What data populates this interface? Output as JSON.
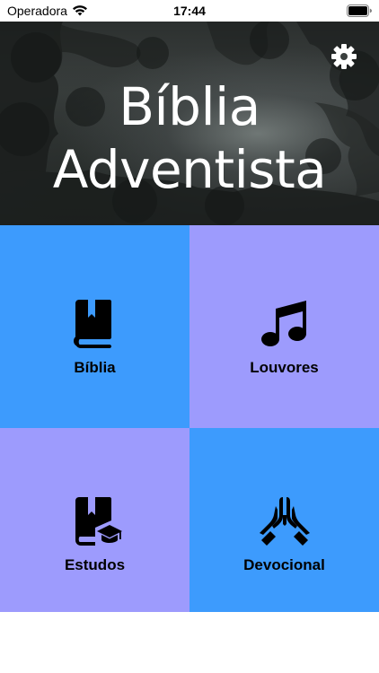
{
  "status_bar": {
    "carrier": "Operadora",
    "time": "17:44",
    "wifi_icon": "wifi-icon",
    "battery_icon": "battery-icon"
  },
  "header": {
    "title_line1": "Bíblia",
    "title_line2": "Adventista",
    "settings_icon": "gear-icon"
  },
  "menu": {
    "items": [
      {
        "label": "Bíblia",
        "icon": "bible-book-icon",
        "color": "#3d9bfd"
      },
      {
        "label": "Louvores",
        "icon": "music-note-icon",
        "color": "#9d9bfd"
      },
      {
        "label": "Estudos",
        "icon": "bible-study-graduation-icon",
        "color": "#9d9bfd"
      },
      {
        "label": "Devocional",
        "icon": "praying-hands-icon",
        "color": "#3d9bfd"
      }
    ]
  }
}
